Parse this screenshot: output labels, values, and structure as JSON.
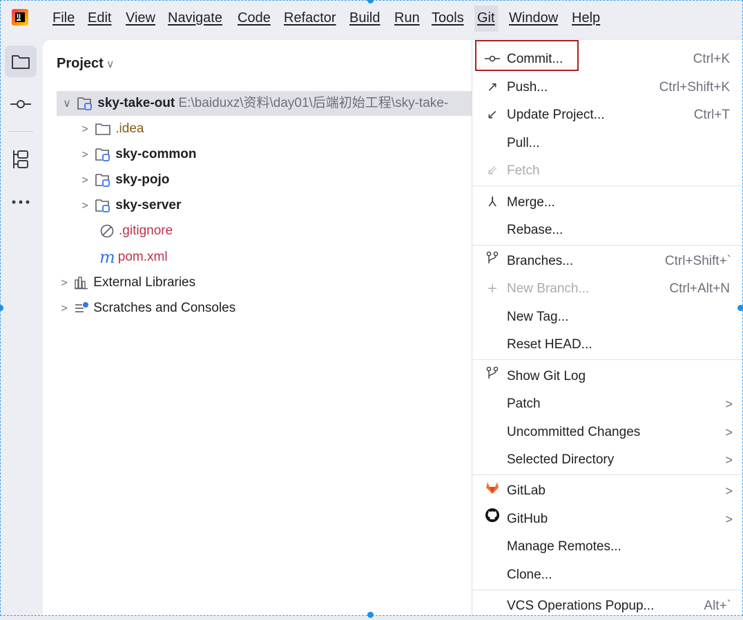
{
  "menubar": {
    "items": [
      "File",
      "Edit",
      "View",
      "Navigate",
      "Code",
      "Refactor",
      "Build",
      "Run",
      "Tools",
      "Git",
      "Window",
      "Help"
    ],
    "active": "Git"
  },
  "toolbar": {
    "icons": [
      "folder-icon",
      "commit-icon",
      "structure-icon",
      "more-icon"
    ]
  },
  "project": {
    "title": "Project",
    "root": {
      "name": "sky-take-out",
      "path": "E:\\baiduxz\\资料\\day01\\后端初始工程\\sky-take-"
    },
    "children": [
      {
        "name": ".idea",
        "style": "folder"
      },
      {
        "name": "sky-common",
        "style": "module"
      },
      {
        "name": "sky-pojo",
        "style": "module"
      },
      {
        "name": "sky-server",
        "style": "module"
      },
      {
        "name": ".gitignore",
        "style": "ignored"
      },
      {
        "name": "pom.xml",
        "style": "maven"
      }
    ],
    "extra": [
      {
        "name": "External Libraries"
      },
      {
        "name": "Scratches and Consoles"
      }
    ]
  },
  "git_menu": {
    "items": [
      {
        "label": "Commit...",
        "shortcut": "Ctrl+K"
      },
      {
        "label": "Push...",
        "shortcut": "Ctrl+Shift+K"
      },
      {
        "label": "Update Project...",
        "shortcut": "Ctrl+T"
      },
      {
        "label": "Pull...",
        "shortcut": ""
      },
      {
        "label": "Fetch",
        "shortcut": ""
      },
      {
        "label": "Merge...",
        "shortcut": ""
      },
      {
        "label": "Rebase...",
        "shortcut": ""
      },
      {
        "label": "Branches...",
        "shortcut": "Ctrl+Shift+`"
      },
      {
        "label": "New Branch...",
        "shortcut": "Ctrl+Alt+N"
      },
      {
        "label": "New Tag...",
        "shortcut": ""
      },
      {
        "label": "Reset HEAD...",
        "shortcut": ""
      },
      {
        "label": "Show Git Log",
        "shortcut": ""
      },
      {
        "label": "Patch",
        "shortcut": ""
      },
      {
        "label": "Uncommitted Changes",
        "shortcut": ""
      },
      {
        "label": "Selected Directory",
        "shortcut": ""
      },
      {
        "label": "GitLab",
        "shortcut": ""
      },
      {
        "label": "GitHub",
        "shortcut": ""
      },
      {
        "label": "Manage Remotes...",
        "shortcut": ""
      },
      {
        "label": "Clone...",
        "shortcut": ""
      },
      {
        "label": "VCS Operations Popup...",
        "shortcut": "Alt+`"
      }
    ],
    "highlight_color": "#b01e1e"
  }
}
